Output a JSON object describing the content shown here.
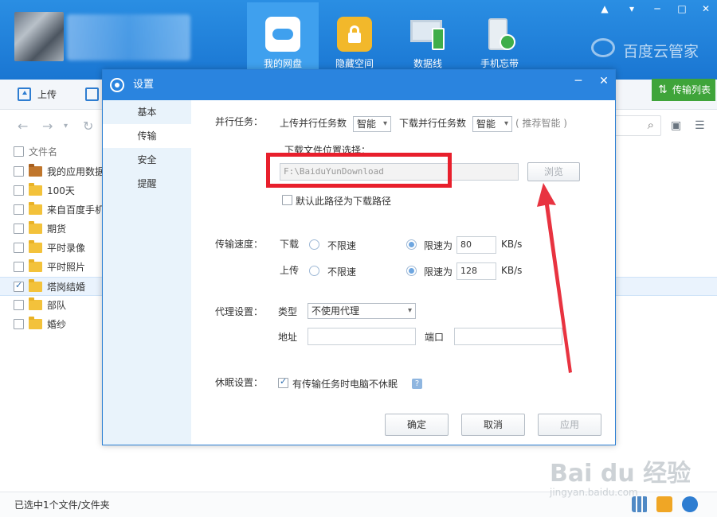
{
  "app": {
    "nav": [
      "我的网盘",
      "隐藏空间",
      "数据线",
      "手机忘带"
    ],
    "brand": "百度云管家",
    "window_controls": [
      "▲",
      "▾",
      "─",
      "□",
      "✕"
    ]
  },
  "toolbar": {
    "upload": "上传",
    "transfer_list": "传输列表"
  },
  "filelist": {
    "header": "文件名",
    "items": [
      {
        "name": "我的应用数据",
        "checked": false,
        "type": "app"
      },
      {
        "name": "100天",
        "checked": false,
        "type": "folder"
      },
      {
        "name": "来自百度手机i",
        "checked": false,
        "type": "folder"
      },
      {
        "name": "期货",
        "checked": false,
        "type": "folder"
      },
      {
        "name": "平时录像",
        "checked": false,
        "type": "folder"
      },
      {
        "name": "平时照片",
        "checked": false,
        "type": "folder"
      },
      {
        "name": "塔岗结婚",
        "checked": true,
        "type": "folder"
      },
      {
        "name": "部队",
        "checked": false,
        "type": "folder"
      },
      {
        "name": "婚纱",
        "checked": false,
        "type": "folder"
      }
    ]
  },
  "status": {
    "selected": "已选中1个文件/文件夹"
  },
  "watermark": {
    "main": "Bai du 经验",
    "sub": "jingyan.baidu.com"
  },
  "dialog": {
    "title": "设置",
    "sidebar": [
      "基本",
      "传输",
      "安全",
      "提醒"
    ],
    "parallel": {
      "label": "并行任务：",
      "upload_label": "上传并行任务数",
      "upload_value": "智能",
      "download_label": "下载并行任务数",
      "download_value": "智能",
      "hint": "( 推荐智能 )"
    },
    "download_location": {
      "label": "下载文件位置选择：",
      "path": "F:\\BaiduYunDownload",
      "browse": "浏览",
      "default_checkbox": "默认此路径为下载路径"
    },
    "speed": {
      "label": "传输速度：",
      "download": "下载",
      "upload": "上传",
      "unlimited": "不限速",
      "limit": "限速为",
      "download_limit": "80",
      "upload_limit": "128",
      "unit": "KB/s"
    },
    "proxy": {
      "label": "代理设置：",
      "type_label": "类型",
      "type_value": "不使用代理",
      "address_label": "地址",
      "port_label": "端口"
    },
    "sleep": {
      "label": "休眠设置：",
      "checkbox": "有传输任务时电脑不休眠",
      "help": "?"
    },
    "buttons": {
      "ok": "确定",
      "cancel": "取消",
      "apply": "应用"
    },
    "controls": [
      "─",
      "✕"
    ]
  },
  "colors": {
    "accent": "#2a84df",
    "highlight": "#e81f2c",
    "green": "#3fa43a"
  }
}
